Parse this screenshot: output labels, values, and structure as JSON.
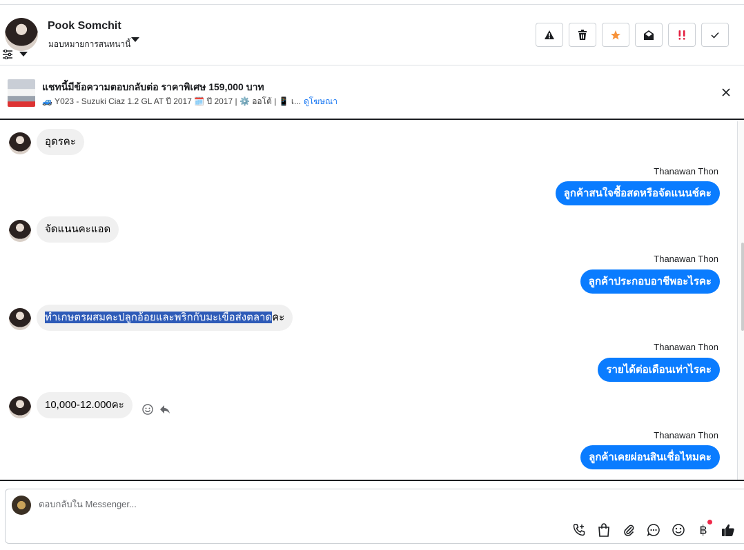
{
  "header": {
    "name": "Pook Somchit",
    "assign_label": "มอบหมายการสนทนานี้",
    "actions": [
      "warning-icon",
      "trash-icon",
      "star-icon",
      "mail-open-icon",
      "important-icon",
      "check-icon"
    ],
    "star_color": "#f7923a",
    "important_color": "#e41e3f"
  },
  "ad": {
    "title": "แชทนี้มีข้อความตอบกลับต่อ ราคาพิเศษ 159,000 บาท",
    "subtitle": "🚙 Y023 - Suzuki Ciaz 1.2 GL AT ปี 2017 🗓️ ปี 2017 | ⚙️ ออโต้ | 📱 เ...",
    "link": "ดูโฆษณา"
  },
  "messages": [
    {
      "dir": "in",
      "text": "อุดรคะ"
    },
    {
      "dir": "out",
      "sender": "Thanawan Thon",
      "text": "ลูกค้าสนใจซื้อสดหรือจัดแนนช์คะ"
    },
    {
      "dir": "in",
      "text": "จัดแนนคะแอด"
    },
    {
      "dir": "out",
      "sender": "Thanawan Thon",
      "text": "ลูกค้าประกอบอาชีพอะไรคะ"
    },
    {
      "dir": "in",
      "text_highlight": "ทำเกษตรผสมคะปลูกอ้อยและพริกกับมะเขือส่งตลาด",
      "text_rest": "คะ"
    },
    {
      "dir": "out",
      "sender": "Thanawan Thon",
      "text": "รายได้ต่อเดือนเท่าไรคะ"
    },
    {
      "dir": "in",
      "text": "10,000-12.000คะ"
    },
    {
      "dir": "out",
      "sender": "Thanawan Thon",
      "text": "ลูกค้าเคยผ่อนสินเชื่อไหมคะ"
    }
  ],
  "composer": {
    "placeholder": "ตอบกลับใน Messenger...",
    "tools": [
      "call-add-icon",
      "shopping-bag-icon",
      "paperclip-icon",
      "chat-bubble-icon",
      "emoji-icon",
      "baht-icon",
      "thumbs-up-icon"
    ],
    "baht_symbol": "฿"
  },
  "colors": {
    "outgoing_bubble": "#0a7cff",
    "incoming_bubble": "#f0f0f0",
    "link": "#1877f2"
  }
}
